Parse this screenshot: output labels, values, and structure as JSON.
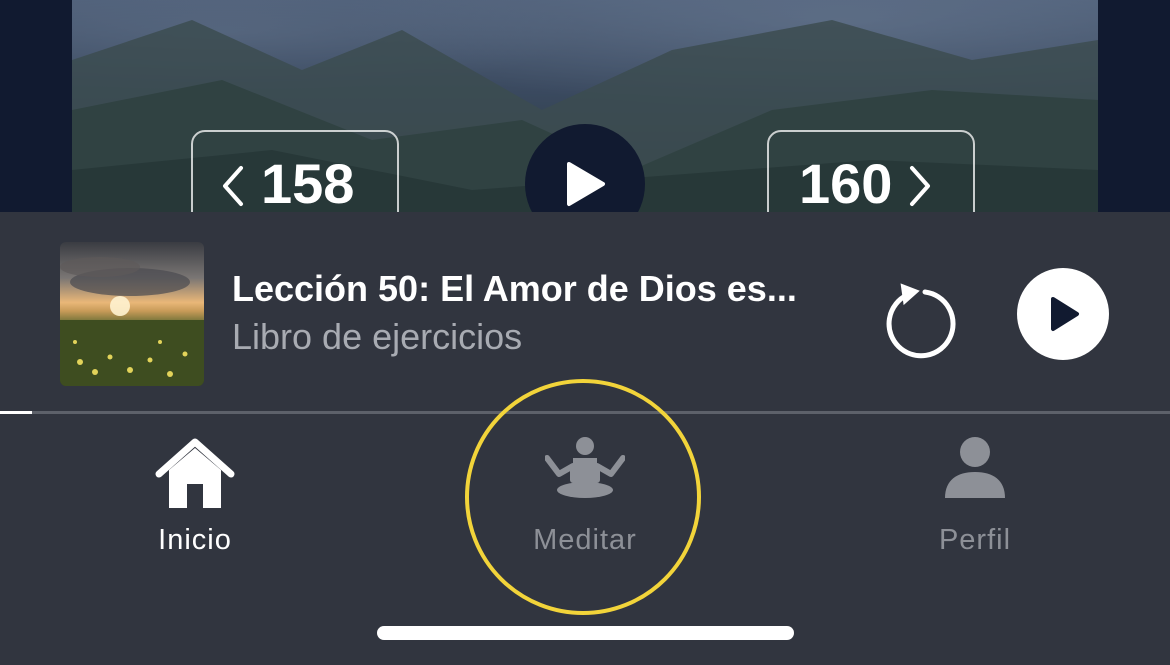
{
  "hero": {
    "prev_label": "158",
    "next_label": "160"
  },
  "player": {
    "title": "Lección 50: El Amor de Dios es...",
    "subtitle": "Libro de ejercicios",
    "progress": 0.027
  },
  "tabs": [
    {
      "label": "Inicio",
      "icon": "home-icon",
      "active": true
    },
    {
      "label": "Meditar",
      "icon": "meditation-icon",
      "active": false
    },
    {
      "label": "Perfil",
      "icon": "person-icon",
      "active": false
    }
  ],
  "colors": {
    "background": "#111a30",
    "panel": "#31353f",
    "highlight_ring": "#f2d43a",
    "inactive_label": "#8d9097"
  }
}
